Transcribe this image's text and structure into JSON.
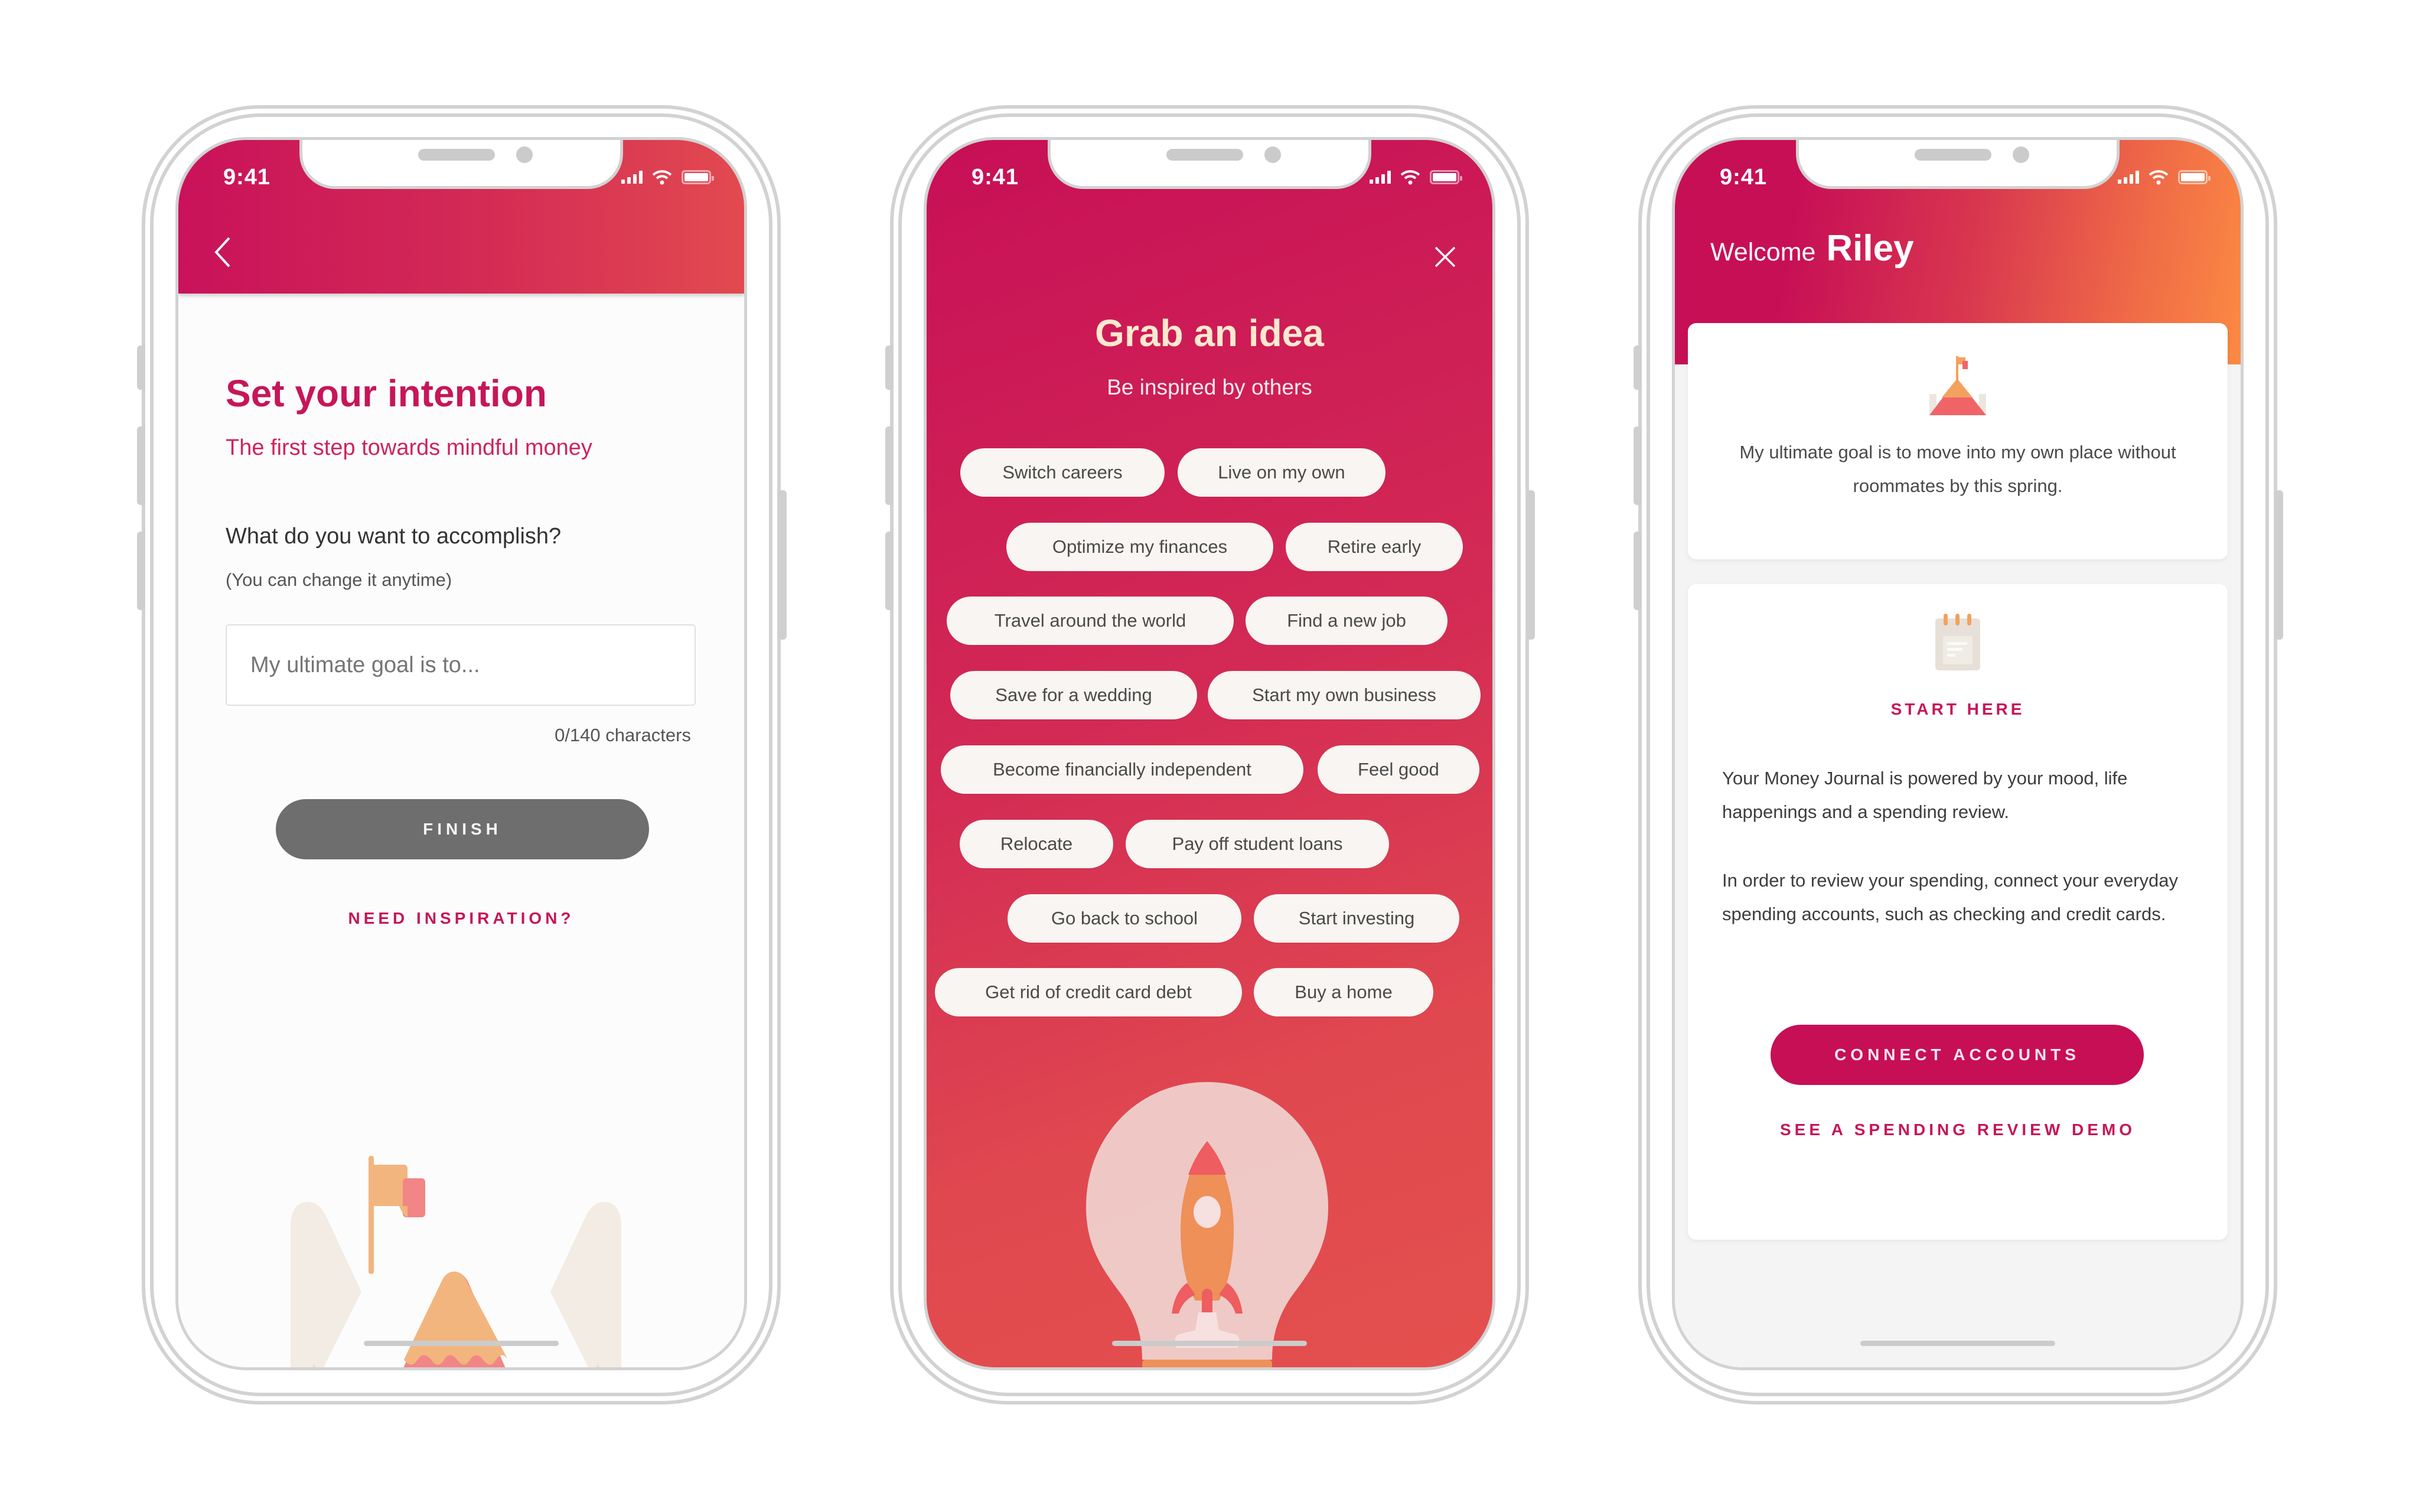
{
  "status_bar": {
    "time": "9:41"
  },
  "screen_intention": {
    "title": "Set your intention",
    "subtitle": "The first step towards mindful money",
    "question": "What do you want to accomplish?",
    "hint": "(You can change it anytime)",
    "goal_input": {
      "value": "",
      "placeholder": "My ultimate goal is to..."
    },
    "char_counter": "0/140 characters",
    "finish_label": "FINISH",
    "inspiration_link": "NEED INSPIRATION?",
    "icons": {
      "back": "chevron-left-icon",
      "illustration": "mountain-flag-illustration"
    }
  },
  "screen_ideas": {
    "title": "Grab an idea",
    "subtitle": "Be inspired by others",
    "ideas": [
      "Switch careers",
      "Live on my own",
      "Optimize my finances",
      "Retire early",
      "Travel around the world",
      "Find a new job",
      "Save for a wedding",
      "Start my own business",
      "Become financially independent",
      "Feel good",
      "Relocate",
      "Pay off student loans",
      "Go back to school",
      "Start investing",
      "Get rid of credit card debt",
      "Buy a home"
    ],
    "icons": {
      "close": "close-icon",
      "illustration": "lightbulb-rocket-illustration"
    }
  },
  "screen_home": {
    "welcome": "Welcome",
    "user_name": "Riley",
    "goal_text": "My ultimate goal is to move into my own place without roommates by this spring.",
    "start_here": "START HERE",
    "journal_paragraph_1": "Your Money Journal is powered by your mood, life happenings and a spending review.",
    "journal_paragraph_2": "In order to review your spending, connect your everyday spending accounts, such as checking and credit cards.",
    "connect_label": "CONNECT ACCOUNTS",
    "demo_link": "SEE A SPENDING REVIEW DEMO",
    "icons": {
      "goal": "mountain-flag-icon",
      "journal": "notepad-icon"
    }
  },
  "colors": {
    "brand_primary": "#c70f56",
    "brand_orange": "#fb8a43",
    "button_disabled": "#6e6e6e",
    "chip_bg": "#f8f5f2",
    "title_cream": "#fde9cf"
  }
}
